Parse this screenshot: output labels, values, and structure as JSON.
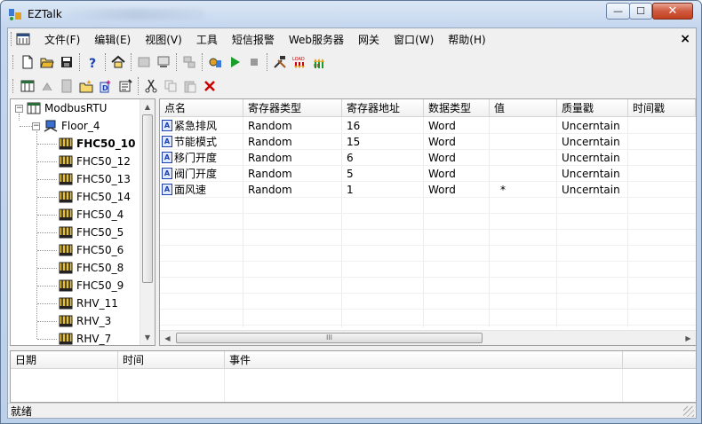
{
  "window": {
    "title": "EZTalk",
    "min_symbol": "—",
    "max_symbol": "☐",
    "close_symbol": "✕"
  },
  "menu": {
    "items": [
      "文件(F)",
      "编辑(E)",
      "视图(V)",
      "工具",
      "短信报警",
      "Web服务器",
      "网关",
      "窗口(W)",
      "帮助(H)"
    ],
    "close_symbol": "×"
  },
  "toolbar1": {
    "icons": [
      "new-file-icon",
      "open-folder-icon",
      "save-icon",
      "help-icon",
      "home-icon",
      "device-icon",
      "monitor-icon",
      "network-icon",
      "run-config-icon",
      "play-icon",
      "stop-icon",
      "tools-icon",
      "load-icon",
      "upload-icon"
    ]
  },
  "toolbar2": {
    "icons": [
      "add-channel-icon",
      "add-device-icon",
      "add-group-icon",
      "add-folder-icon",
      "add-tag-icon",
      "properties-icon",
      "cut-icon",
      "copy-icon",
      "paste-icon",
      "delete-icon"
    ]
  },
  "tree": {
    "root": "ModbusRTU",
    "group": "Floor_4",
    "selected": "FHC50_10",
    "items": [
      "FHC50_10",
      "FHC50_12",
      "FHC50_13",
      "FHC50_14",
      "FHC50_4",
      "FHC50_5",
      "FHC50_6",
      "FHC50_8",
      "FHC50_9",
      "RHV_11",
      "RHV_3",
      "RHV_7"
    ]
  },
  "grid": {
    "columns": [
      "点名",
      "寄存器类型",
      "寄存器地址",
      "数据类型",
      "值",
      "质量戳",
      "时间戳"
    ],
    "tag_icon_text": "A",
    "rows": [
      {
        "name": "紧急排风",
        "reg_type": "Random",
        "reg_addr": "16",
        "data_type": "Word",
        "value": "",
        "quality": "Uncerntain",
        "timestamp": ""
      },
      {
        "name": "节能模式",
        "reg_type": "Random",
        "reg_addr": "15",
        "data_type": "Word",
        "value": "",
        "quality": "Uncerntain",
        "timestamp": ""
      },
      {
        "name": "移门开度",
        "reg_type": "Random",
        "reg_addr": "6",
        "data_type": "Word",
        "value": "",
        "quality": "Uncerntain",
        "timestamp": ""
      },
      {
        "name": "阀门开度",
        "reg_type": "Random",
        "reg_addr": "5",
        "data_type": "Word",
        "value": "",
        "quality": "Uncerntain",
        "timestamp": ""
      },
      {
        "name": "面风速",
        "reg_type": "Random",
        "reg_addr": "1",
        "data_type": "Word",
        "value": "*",
        "quality": "Uncerntain",
        "timestamp": ""
      }
    ],
    "scroll_grip": "III"
  },
  "log": {
    "columns": [
      "日期",
      "时间",
      "事件"
    ]
  },
  "status": {
    "text": "就绪"
  },
  "colors": {
    "accent": "#1a3fb0",
    "title_bg": "#c4d6ee",
    "close_red": "#c2401f"
  }
}
